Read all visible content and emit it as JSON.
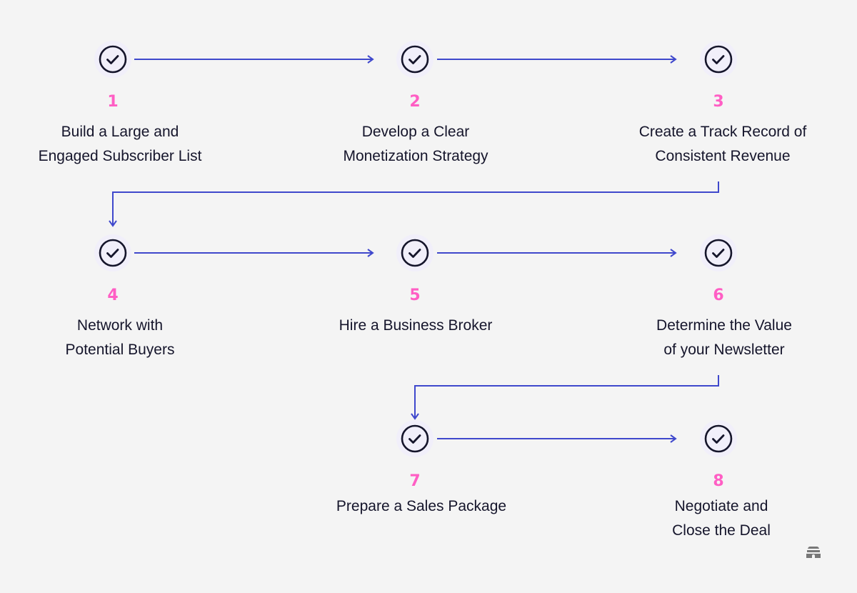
{
  "accent_color": "#3f48cc",
  "number_color": "#ff5ec4",
  "steps": [
    {
      "number": "1",
      "label": "Build a Large and\nEngaged Subscriber List",
      "icon": "check-circle-icon"
    },
    {
      "number": "2",
      "label": "Develop a Clear\nMonetization Strategy",
      "icon": "check-circle-icon"
    },
    {
      "number": "3",
      "label": "Create a Track Record of\nConsistent Revenue",
      "icon": "check-circle-icon"
    },
    {
      "number": "4",
      "label": "Network with\nPotential Buyers",
      "icon": "check-circle-icon"
    },
    {
      "number": "5",
      "label": "Hire a Business Broker",
      "icon": "check-circle-icon"
    },
    {
      "number": "6",
      "label": "Determine the Value\nof your Newsletter",
      "icon": "check-circle-icon"
    },
    {
      "number": "7",
      "label": "Prepare a Sales Package",
      "icon": "check-circle-icon"
    },
    {
      "number": "8",
      "label": "Negotiate and\nClose the Deal",
      "icon": "check-circle-icon"
    }
  ],
  "logo": "beehive-logo-icon"
}
